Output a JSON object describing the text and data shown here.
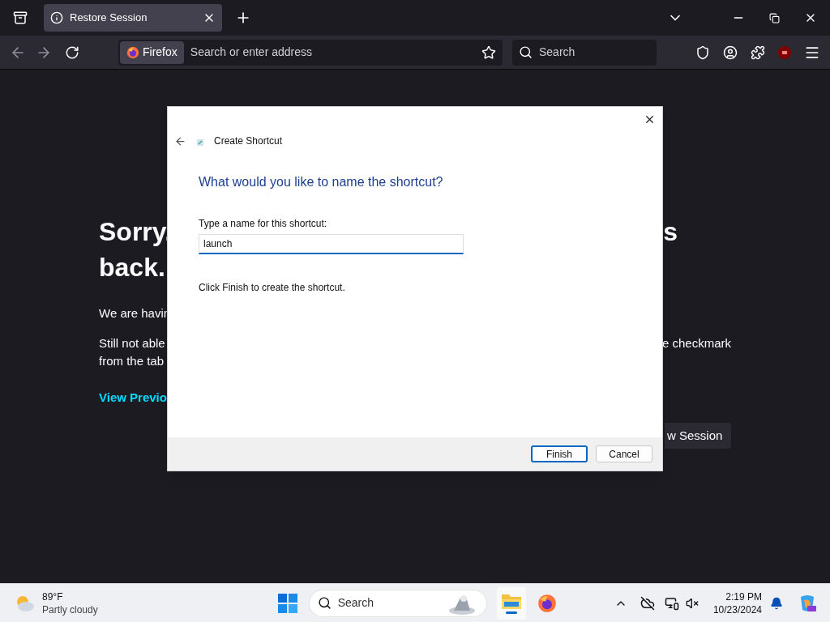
{
  "browser": {
    "tabs": [
      {
        "title": "Restore Session",
        "selected": true
      }
    ],
    "identity_label": "Firefox",
    "address_placeholder": "Search or enter address",
    "search_placeholder": "Search"
  },
  "page": {
    "heading_left": "Sorry.",
    "heading_right": "s",
    "heading_line2": "back.",
    "para1": "We are havin",
    "para2_left": "Still not able",
    "para2_right": "e checkmark",
    "para2_line2": "from the tab",
    "link": "View Previo",
    "button": "w Session"
  },
  "dialog": {
    "title": "Create Shortcut",
    "question": "What would you like to name the shortcut?",
    "field_label": "Type a name for this shortcut:",
    "field_value": "launch",
    "hint": "Click Finish to create the shortcut.",
    "buttons": [
      {
        "label": "Finish",
        "default": true
      },
      {
        "label": "Cancel",
        "default": false
      }
    ]
  },
  "taskbar": {
    "temperature": "89°F",
    "condition": "Partly cloudy",
    "search_placeholder": "Search",
    "time": "2:19 PM",
    "date": "10/23/2024"
  }
}
